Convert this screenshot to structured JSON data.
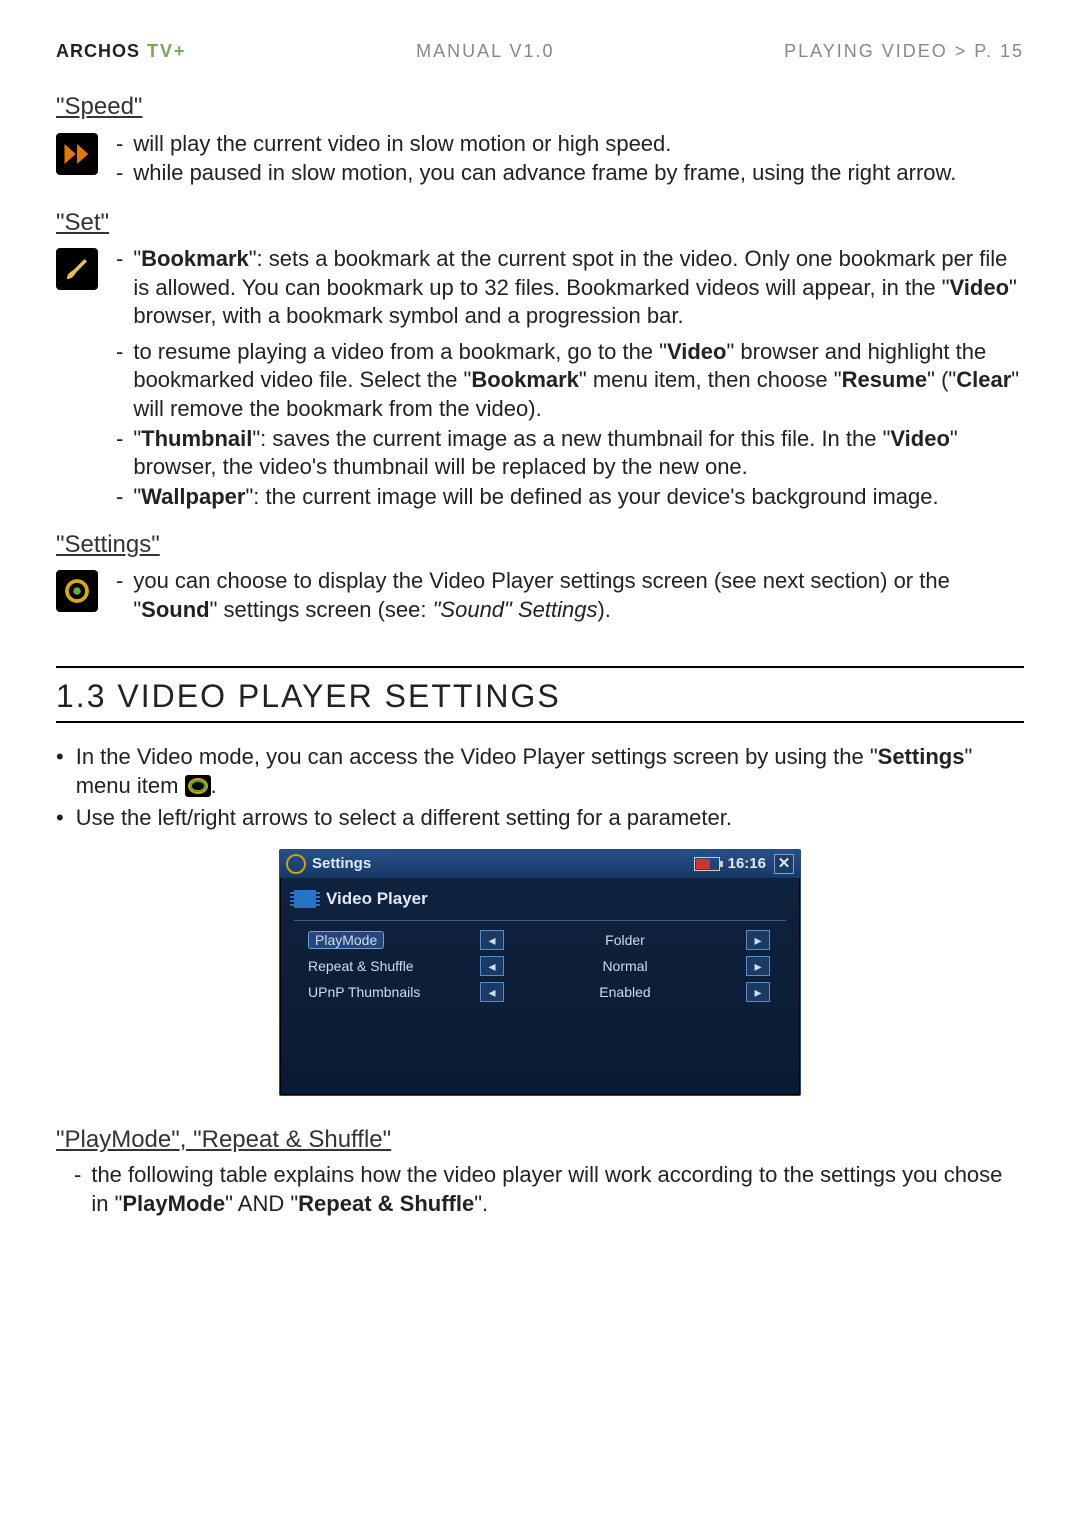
{
  "header": {
    "brand": "ARCHOS",
    "product": "TV+",
    "center": "MANUAL V1.0",
    "crumb": "PLAYING VIDEO   >   P. 15"
  },
  "speed": {
    "title": "\"Speed\"",
    "b1": "will play the current video in slow motion or high speed.",
    "b2": "while paused in slow motion, you can advance frame by frame, using the right arrow."
  },
  "set": {
    "title": "\"Set\"",
    "b1a": "\"",
    "b1b": "Bookmark",
    "b1c": "\": sets a bookmark at the current spot in the video. Only one bookmark per file is allowed. You can bookmark up to 32 files. Bookmarked videos will appear, in the \"",
    "b1d": "Video",
    "b1e": "\" browser, with a bookmark symbol and a progression bar.",
    "b2a": "to resume playing a video from a bookmark, go to the \"",
    "b2b": "Video",
    "b2c": "\" browser and highlight the bookmarked video file. Select the \"",
    "b2d": "Bookmark",
    "b2e": "\" menu item, then choose \"",
    "b2f": "Resume",
    "b2g": "\" (\"",
    "b2h": "Clear",
    "b2i": "\" will remove the bookmark from the video).",
    "b3a": "\"",
    "b3b": "Thumbnail",
    "b3c": "\": saves the current image as a new thumbnail for this file. In the \"",
    "b3d": "Video",
    "b3e": "\" browser, the video's thumbnail will be replaced by the new one.",
    "b4a": "\"",
    "b4b": "Wallpaper",
    "b4c": "\": the current image will be defined as your device's background image."
  },
  "settings": {
    "title": "\"Settings\"",
    "p1a": "you can choose to display the Video Player settings screen (see next section) or the \"",
    "p1b": "Sound",
    "p1c": "\" settings screen (see: ",
    "p1d": "\"Sound\" Settings",
    "p1e": ")."
  },
  "h2": "1.3  VIDEO PLAYER SETTINGS",
  "intro": {
    "l1a": "In the Video mode, you can access the Video Player settings screen by using the \"",
    "l1b": "Settings",
    "l1c": "\" menu item ",
    "l2": "Use the left/right arrows to select a different setting for a parameter."
  },
  "shot": {
    "title": "Settings",
    "clock": "16:16",
    "sub": "Video Player",
    "rows": [
      {
        "label": "PlayMode",
        "value": "Folder",
        "selected": true
      },
      {
        "label": "Repeat & Shuffle",
        "value": "Normal",
        "selected": false
      },
      {
        "label": "UPnP Thumbnails",
        "value": "Enabled",
        "selected": false
      }
    ]
  },
  "pm": {
    "title": "\"PlayMode\", \"Repeat & Shuffle\"",
    "p1a": "the following table explains how the video player will work according to the settings you chose in \"",
    "p1b": "PlayMode",
    "p1c": "\" AND \"",
    "p1d": "Repeat & Shuffle",
    "p1e": "\"."
  },
  "dash": "-",
  "dot": "•",
  "period": "."
}
